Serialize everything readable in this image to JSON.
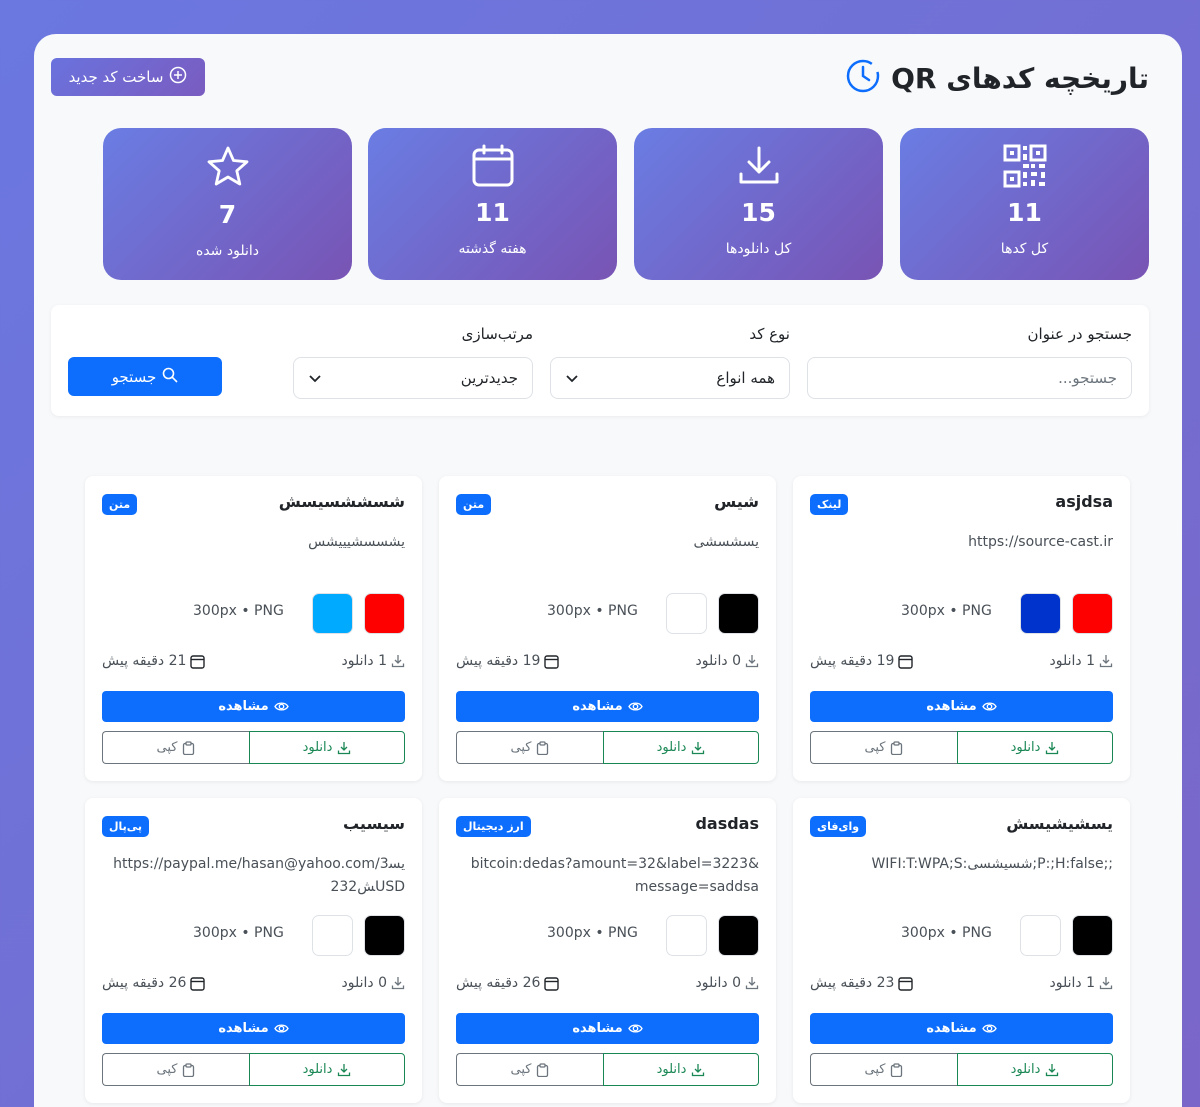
{
  "header": {
    "title": "تاریخچه کدهای QR",
    "new_button_label": "ساخت کد جدید"
  },
  "stats": [
    {
      "value": "11",
      "label": "کل کدها",
      "icon": "qr-code-icon"
    },
    {
      "value": "15",
      "label": "کل دانلودها",
      "icon": "download-icon"
    },
    {
      "value": "11",
      "label": "هفته گذشته",
      "icon": "calendar-icon"
    },
    {
      "value": "7",
      "label": "دانلود شده",
      "icon": "star-icon"
    }
  ],
  "filters": {
    "search_label": "جستجو در عنوان",
    "search_placeholder": "جستجو...",
    "type_label": "نوع کد",
    "type_value": "همه انواع",
    "sort_label": "مرتب‌سازی",
    "sort_value": "جدیدترین",
    "search_button": "جستجو"
  },
  "card_labels": {
    "view": "مشاهده",
    "download": "دانلود",
    "copy": "کپی"
  },
  "cards": [
    {
      "title": "asjdsa",
      "badge": "لینک",
      "content": "https://source-cast.ir",
      "fg": "#ff0000",
      "bg": "#0033cc",
      "meta": "300px • PNG",
      "downloads": "1 دانلود",
      "time": "19 دقیقه پیش"
    },
    {
      "title": "شیس",
      "badge": "متن",
      "content": "یسشسشی",
      "fg": "#000000",
      "bg": "#ffffff",
      "meta": "300px • PNG",
      "downloads": "0 دانلود",
      "time": "19 دقیقه پیش"
    },
    {
      "title": "شسششسیسش",
      "badge": "متن",
      "content": "یشسسشیییشس",
      "fg": "#ff0000",
      "bg": "#00aaff",
      "meta": "300px • PNG",
      "downloads": "1 دانلود",
      "time": "21 دقیقه پیش"
    },
    {
      "title": "یسشیشیسش",
      "badge": "وای‌فای",
      "content": "WIFI:T:WPA;S:شسیشسی;P:;H:false;;",
      "fg": "#000000",
      "bg": "#ffffff",
      "meta": "300px • PNG",
      "downloads": "1 دانلود",
      "time": "23 دقیقه پیش"
    },
    {
      "title": "dasdas",
      "badge": "ارز دیجیتال",
      "content": "bitcoin:dedas?amount=32&label=3223&message=saddsa",
      "fg": "#000000",
      "bg": "#ffffff",
      "meta": "300px • PNG",
      "downloads": "0 دانلود",
      "time": "26 دقیقه پیش"
    },
    {
      "title": "سیسیب",
      "badge": "پی‌پال",
      "content": "https://paypal.me/hasan@yahoo.com/3یسش232USD",
      "fg": "#000000",
      "bg": "#ffffff",
      "meta": "300px • PNG",
      "downloads": "0 دانلود",
      "time": "26 دقیقه پیش"
    }
  ]
}
